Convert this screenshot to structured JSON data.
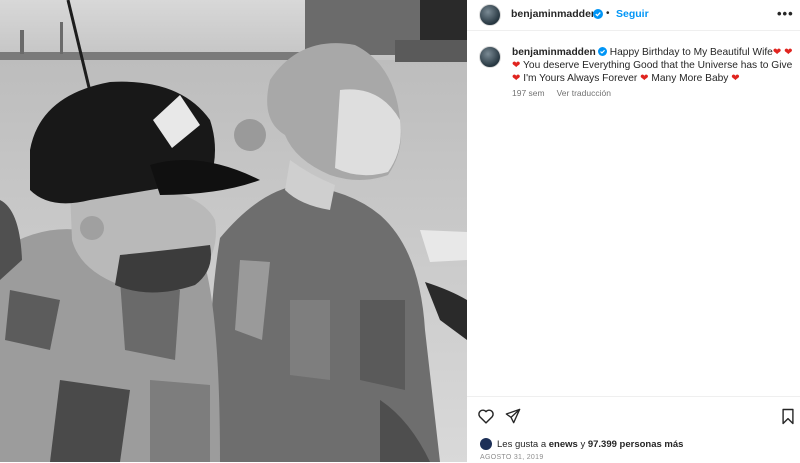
{
  "header": {
    "username": "benjaminmadden",
    "separator": "•",
    "follow_label": "Seguir",
    "more_label": "•••"
  },
  "caption": {
    "username": "benjaminmadden",
    "line1": "Happy Birthday to My Beautiful Wife",
    "line2": "You deserve Everything Good that the Universe has to Give",
    "line3a": "I'm Yours Always Forever",
    "line3b": "Many More Baby",
    "heart": "❤"
  },
  "meta": {
    "age": "197 sem",
    "translate": "Ver traducción"
  },
  "likes": {
    "prefix": "Les gusta a",
    "first_user": "enews",
    "connector": "y",
    "count": "97.399 personas más"
  },
  "date": "AGOSTO 31, 2019",
  "icons": [
    "heart-outline-icon",
    "share-icon",
    "bookmark-icon",
    "verified-icon"
  ],
  "colors": {
    "accent": "#0095f6",
    "heart": "#e0241f",
    "muted": "#737373"
  }
}
